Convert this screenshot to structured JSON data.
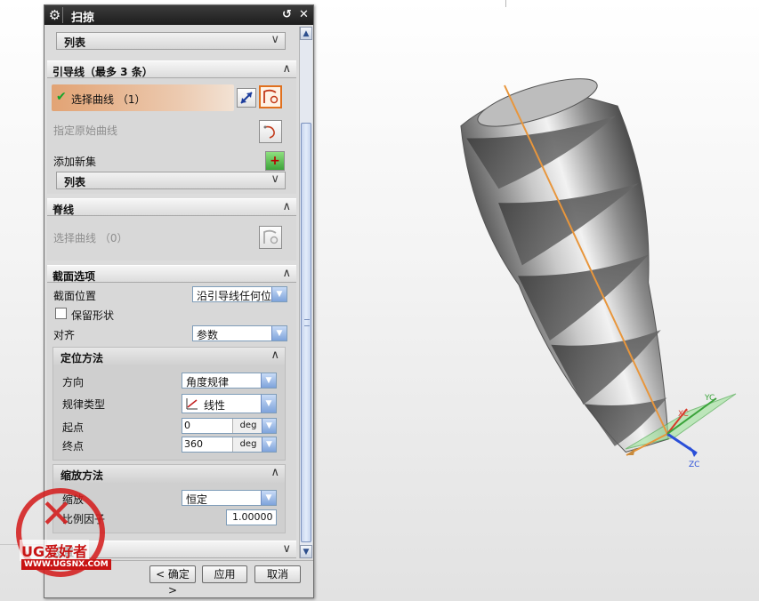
{
  "dialog": {
    "title": "扫掠",
    "top_list_label": "列表",
    "guide_group": {
      "header": "引导线（最多 3 条）",
      "select_curve_label": "选择曲线 （1）",
      "specify_original_curve": "指定原始曲线",
      "add_new_set": "添加新集",
      "list_label": "列表"
    },
    "spine_group": {
      "header": "脊线",
      "select_curve_label": "选择曲线 （0）"
    },
    "section_options": {
      "header": "截面选项",
      "section_position_label": "截面位置",
      "section_position_value": "沿引导线任何位",
      "keep_shape_label": "保留形状",
      "keep_shape_checked": false,
      "alignment_label": "对齐",
      "alignment_value": "参数"
    },
    "orientation_method": {
      "header": "定位方法",
      "direction_label": "方向",
      "direction_value": "角度规律",
      "law_type_label": "规律类型",
      "law_type_value": "线性",
      "start_label": "起点",
      "start_value": "0",
      "start_unit": "deg",
      "end_label": "终点",
      "end_value": "360",
      "end_unit": "deg"
    },
    "scaling_method": {
      "header": "缩放方法",
      "scaling_label": "缩放",
      "scaling_value": "恒定",
      "scale_factor_label": "比例因子",
      "scale_factor_value": "1.00000"
    },
    "settings_header": "设置",
    "buttons": {
      "ok": "< 确定 >",
      "apply": "应用",
      "cancel": "取消"
    }
  },
  "viewport": {
    "axis_labels": {
      "x": "XC",
      "y": "YC",
      "z": "ZC"
    },
    "colors": {
      "guide_line": "#e8963c",
      "plane": "#7fd07a",
      "x_axis": "#d83a2a",
      "y_axis": "#3aa33a",
      "z_axis": "#2a4fd8",
      "part": "#9a9a9a"
    }
  },
  "watermark": {
    "brand": "UG爱好者",
    "url": "WWW.UGSNX.COM"
  }
}
